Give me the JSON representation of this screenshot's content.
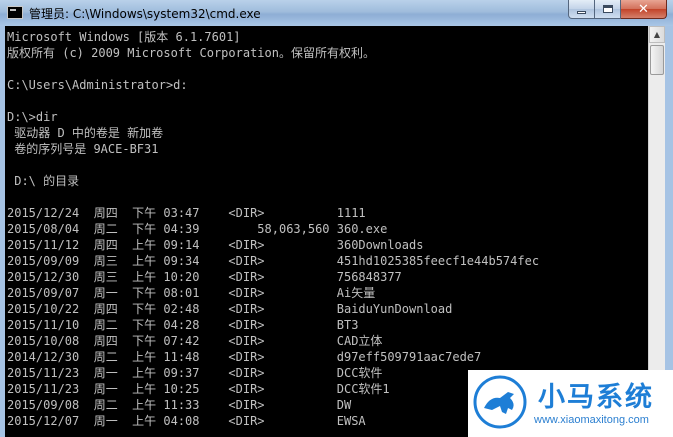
{
  "window": {
    "title": "管理员: C:\\Windows\\system32\\cmd.exe",
    "controls": {
      "minimize": "",
      "maximize": "",
      "close": "✕"
    }
  },
  "console": {
    "lines": [
      "Microsoft Windows [版本 6.1.7601]",
      "版权所有 (c) 2009 Microsoft Corporation。保留所有权利。",
      "",
      "C:\\Users\\Administrator>d:",
      "",
      "D:\\>dir",
      " 驱动器 D 中的卷是 新加卷",
      " 卷的序列号是 9ACE-BF31",
      "",
      " D:\\ 的目录",
      "",
      "2015/12/24  周四  下午 03:47    <DIR>          1111",
      "2015/08/04  周二  下午 04:39        58,063,560 360.exe",
      "2015/11/12  周四  上午 09:14    <DIR>          360Downloads",
      "2015/09/09  周三  上午 09:34    <DIR>          451hd1025385feecf1e44b574fec",
      "2015/12/30  周三  上午 10:20    <DIR>          756848377",
      "2015/09/07  周一  下午 08:01    <DIR>          Ai矢量",
      "2015/10/22  周四  下午 02:48    <DIR>          BaiduYunDownload",
      "2015/11/10  周二  下午 04:28    <DIR>          BT3",
      "2015/10/08  周四  下午 07:42    <DIR>          CAD立体",
      "2014/12/30  周二  上午 11:48    <DIR>          d97eff509791aac7ede7",
      "2015/11/23  周一  上午 09:37    <DIR>          DCC软件",
      "2015/11/23  周一  上午 10:25    <DIR>          DCC软件1",
      "2015/09/08  周二  上午 11:33    <DIR>          DW",
      "2015/12/07  周一  上午 04:08    <DIR>          EWSA"
    ]
  },
  "scrollbar": {
    "up_arrow": "▲"
  },
  "watermark": {
    "brand": "小马系统",
    "url": "www.xiaomaxitong.com"
  },
  "colors": {
    "console_bg": "#000000",
    "console_text": "#c0c0c0",
    "brand": "#1e7ed6"
  }
}
